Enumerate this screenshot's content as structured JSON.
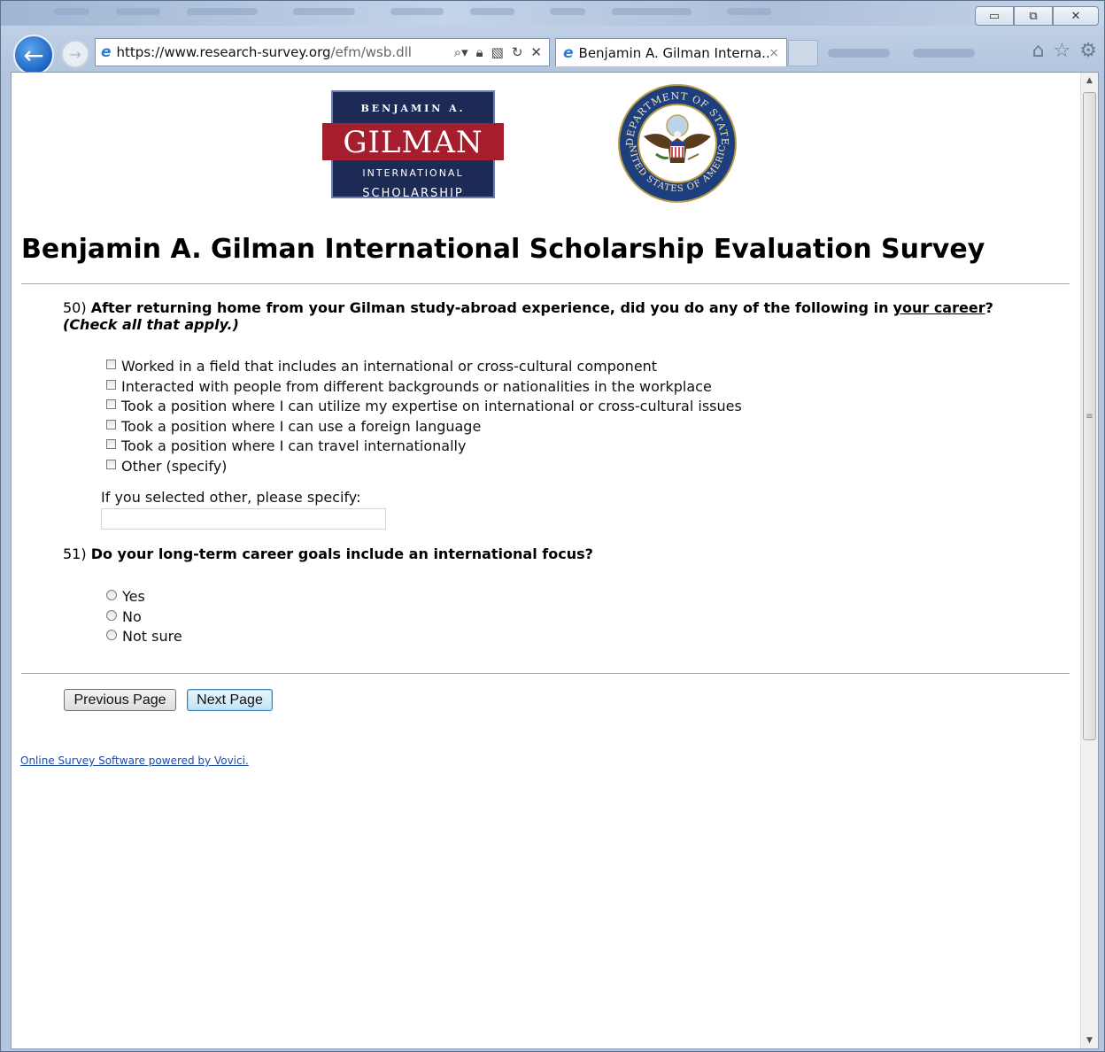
{
  "browser": {
    "address": {
      "scheme": "https://",
      "host": "www.research-survey.org",
      "path": "/efm/wsb.dll"
    },
    "tab": {
      "title": "Benjamin A. Gilman Interna...",
      "close": "×"
    },
    "window_controls": {
      "minimize": "▭",
      "restore": "⧉",
      "close": "✕"
    },
    "icons": [
      "back-arrow-icon",
      "forward-arrow-icon",
      "ie-logo-icon",
      "search-icon",
      "lock-icon",
      "compat-view-icon",
      "refresh-icon",
      "stop-icon",
      "home-icon",
      "favorites-star-icon",
      "gear-icon"
    ],
    "accent": "#1d64c0"
  },
  "logos": {
    "gilman": {
      "line1": "BENJAMIN A.",
      "line2": "GILMAN",
      "line3": "INTERNATIONAL",
      "line4": "SCHOLARSHIP",
      "colors": {
        "navy": "#1d2a55",
        "red": "#a61e2e"
      }
    },
    "seal": {
      "top": "DEPARTMENT OF STATE",
      "bottom": "UNITED STATES OF AMERICA"
    }
  },
  "survey": {
    "title": "Benjamin A. Gilman International Scholarship Evaluation Survey",
    "q50": {
      "number": "50)",
      "text_before": "After returning home from your Gilman study-abroad experience, did you do any of the following in",
      "text_underlined": "your career",
      "text_after": "?",
      "note": "(Check all that apply.)",
      "options": [
        "Worked in a field that includes an international or cross-cultural component",
        "Interacted with people from different backgrounds or nationalities in the workplace",
        "Took a position where I can utilize my expertise on international or cross-cultural issues",
        "Took a position where I can use a foreign language",
        "Took a position where I can travel internationally",
        "Other (specify)"
      ],
      "specify_label": "If you selected other, please specify:",
      "specify_value": ""
    },
    "q51": {
      "number": "51)",
      "text": "Do your long-term career goals include an international focus?",
      "options": [
        "Yes",
        "No",
        "Not sure"
      ]
    },
    "buttons": {
      "previous": "Previous Page",
      "next": "Next Page"
    },
    "footer": "Online Survey Software powered by Vovici."
  }
}
